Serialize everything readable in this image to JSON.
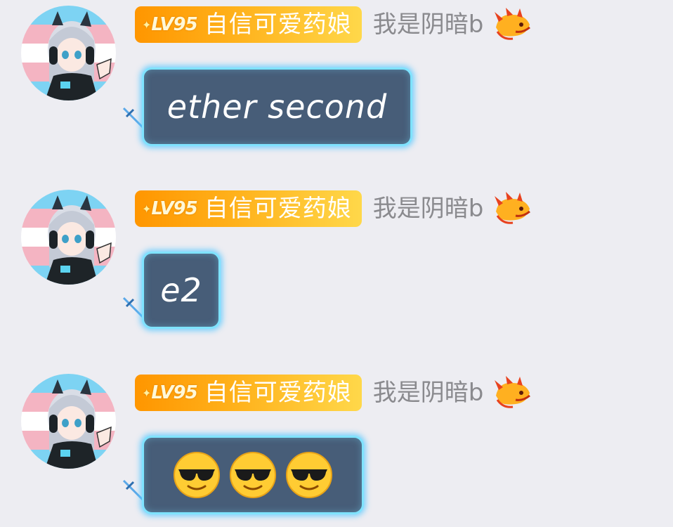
{
  "messages": [
    {
      "level": "LV95",
      "title": "自信可爱药娘",
      "nickname": "我是阴暗b",
      "text": "ether second",
      "kind": "text"
    },
    {
      "level": "LV95",
      "title": "自信可爱药娘",
      "nickname": "我是阴暗b",
      "text": "e2",
      "kind": "text"
    },
    {
      "level": "LV95",
      "title": "自信可爱药娘",
      "nickname": "我是阴暗b",
      "emojis": [
        "sunglasses-emoji",
        "sunglasses-emoji",
        "sunglasses-emoji"
      ],
      "kind": "emoji"
    }
  ],
  "colors": {
    "background": "#ededf2",
    "bubble": "#475d78",
    "bubble_glow": "#7fe3ff",
    "badge_start": "#ff9600",
    "badge_end": "#ffd84a",
    "nickname": "#8a8a8e"
  }
}
